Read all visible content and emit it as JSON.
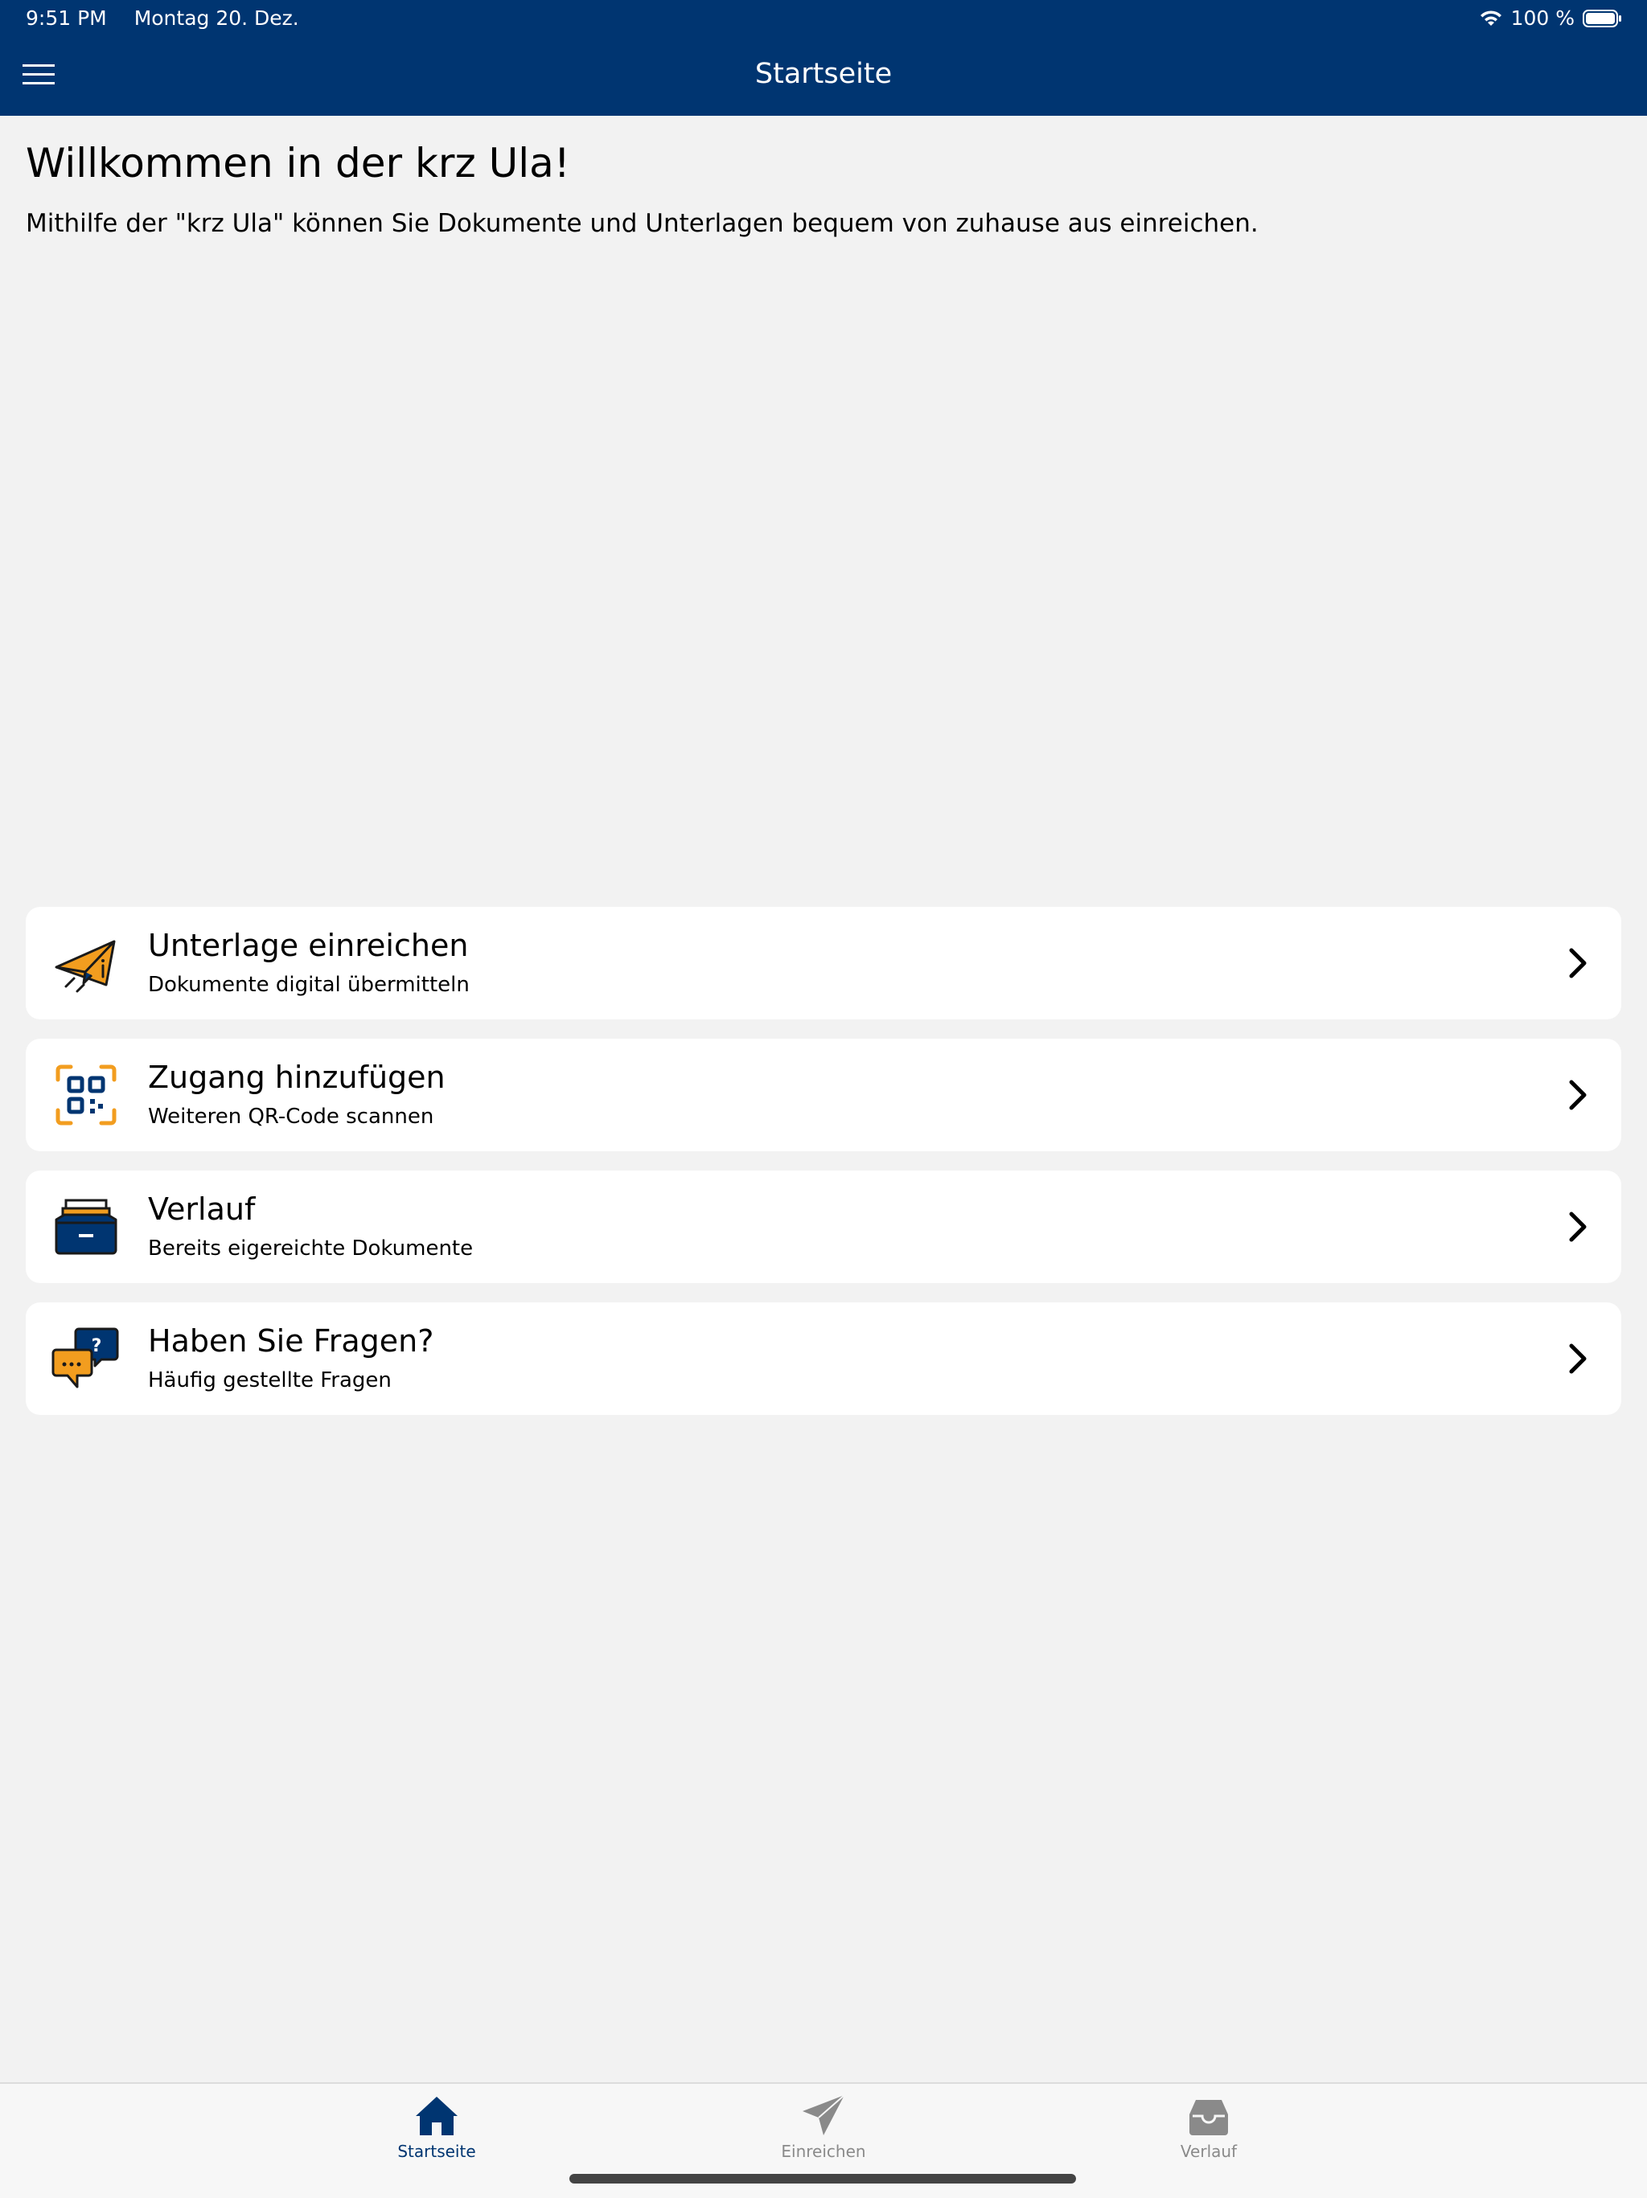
{
  "status_bar": {
    "time": "9:51 PM",
    "date": "Montag 20. Dez.",
    "battery": "100 %"
  },
  "header": {
    "title": "Startseite"
  },
  "welcome": {
    "title": "Willkommen in der krz Ula!",
    "text": "Mithilfe der \"krz Ula\" können Sie Dokumente und Unterlagen bequem von zuhause aus einreichen."
  },
  "cards": [
    {
      "title": "Unterlage einreichen",
      "subtitle": "Dokumente digital übermitteln",
      "icon": "paper-plane-icon"
    },
    {
      "title": "Zugang hinzufügen",
      "subtitle": "Weiteren QR-Code scannen",
      "icon": "qr-code-icon"
    },
    {
      "title": "Verlauf",
      "subtitle": "Bereits eigereichte Dokumente",
      "icon": "archive-drawer-icon"
    },
    {
      "title": "Haben Sie Fragen?",
      "subtitle": "Häufig gestellte Fragen",
      "icon": "chat-question-icon"
    }
  ],
  "tabs": [
    {
      "label": "Startseite",
      "icon": "home-icon",
      "active": true
    },
    {
      "label": "Einreichen",
      "icon": "send-icon",
      "active": false
    },
    {
      "label": "Verlauf",
      "icon": "inbox-icon",
      "active": false
    }
  ],
  "colors": {
    "primary": "#003571",
    "accent": "#f29d1f",
    "background": "#f2f2f2"
  }
}
